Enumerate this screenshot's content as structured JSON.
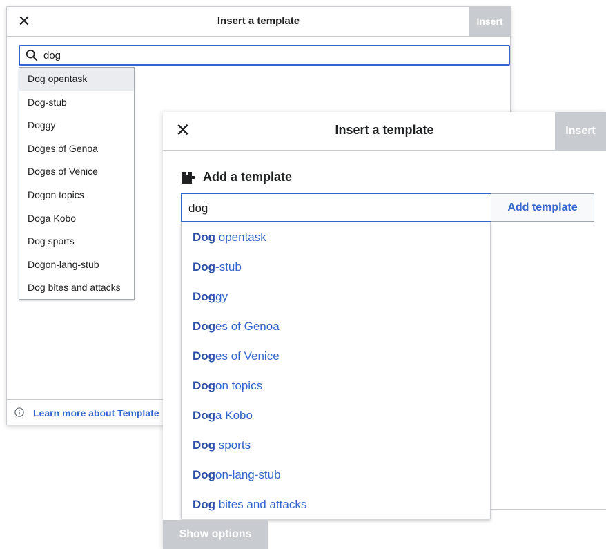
{
  "back_dialog": {
    "close_glyph": "✕",
    "title": "Insert a template",
    "insert_label": "Insert",
    "search_value": "dog",
    "suggestions": [
      "Dog opentask",
      "Dog-stub",
      "Doggy",
      "Doges of Genoa",
      "Doges of Venice",
      "Dogon topics",
      "Doga Kobo",
      "Dog sports",
      "Dogon-lang-stub",
      "Dog bites and attacks"
    ],
    "highlighted_index": 0,
    "footer_link": "Learn more about Template"
  },
  "front_dialog": {
    "close_glyph": "✕",
    "title": "Insert a template",
    "insert_label": "Insert",
    "section_title": "Add a template",
    "input_value": "dog",
    "add_button": "Add template",
    "results": [
      {
        "match": "Dog",
        "rest": " opentask"
      },
      {
        "match": "Dog",
        "rest": "-stub"
      },
      {
        "match": "Dog",
        "rest": "gy"
      },
      {
        "match": "Dog",
        "rest": "es of Genoa"
      },
      {
        "match": "Dog",
        "rest": "es of Venice"
      },
      {
        "match": "Dog",
        "rest": "on topics"
      },
      {
        "match": "Dog",
        "rest": "a Kobo"
      },
      {
        "match": "Dog",
        "rest": " sports"
      },
      {
        "match": "Dog",
        "rest": "on-lang-stub"
      },
      {
        "match": "Dog",
        "rest": " bites and attacks"
      }
    ],
    "show_options": "Show options"
  },
  "icons": {
    "search": "search-icon",
    "close": "close-icon",
    "puzzle": "puzzle-icon",
    "info": "info-icon"
  },
  "colors": {
    "accent": "#3366cc",
    "disabled_button": "#c8ccd1",
    "border": "#c8ccd1"
  }
}
